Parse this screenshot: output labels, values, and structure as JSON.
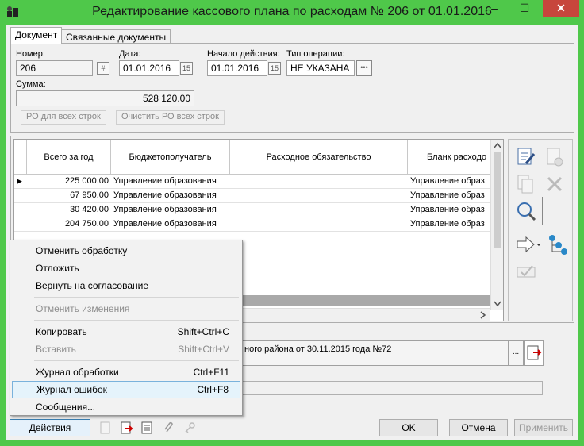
{
  "window": {
    "title": "Редактирование кассового плана по расходам № 206 от 01.01.2016",
    "min": "–",
    "max": "☐",
    "close": "✕"
  },
  "tabs": [
    "Документ",
    "Связанные документы"
  ],
  "form": {
    "number_label": "Номер:",
    "number_value": "206",
    "date_label": "Дата:",
    "date_value": "01.01.2016",
    "start_label": "Начало действия:",
    "start_value": "01.01.2016",
    "optype_label": "Тип операции:",
    "optype_value": "НЕ УКАЗАНА",
    "optype_btn": "•••",
    "sum_label": "Сумма:",
    "sum_value": "528 120.00",
    "btn_ro_all": "РО для всех строк",
    "btn_clear_ro": "Очистить РО  всех строк",
    "calendar_icon": "15",
    "hash_icon": "#"
  },
  "grid": {
    "columns": [
      "Всего за год",
      "Бюджетополучатель",
      "Расходное обязательство",
      "Бланк расходо"
    ],
    "rows": [
      [
        "225 000.00",
        "Управление образования",
        "",
        "Управление образ"
      ],
      [
        "67 950.00",
        "Управление образования",
        "",
        "Управление образ"
      ],
      [
        "30 420.00",
        "Управление образования",
        "",
        "Управление образ"
      ],
      [
        "204 750.00",
        "Управление образования",
        "",
        "Управление образ"
      ]
    ]
  },
  "basis": {
    "text": "ного района от 30.11.2015 года №72",
    "dots": "..."
  },
  "menu": {
    "items": [
      {
        "label": "Отменить обработку",
        "shortcut": "",
        "disabled": false
      },
      {
        "label": "Отложить",
        "shortcut": "",
        "disabled": false
      },
      {
        "label": "Вернуть на согласование",
        "shortcut": "",
        "disabled": false
      },
      {
        "label": "Отменить изменения",
        "shortcut": "",
        "disabled": true
      },
      {
        "label": "Копировать",
        "shortcut": "Shift+Ctrl+C",
        "disabled": false
      },
      {
        "label": "Вставить",
        "shortcut": "Shift+Ctrl+V",
        "disabled": true
      },
      {
        "label": "Журнал обработки",
        "shortcut": "Ctrl+F11",
        "disabled": false
      },
      {
        "label": "Журнал ошибок",
        "shortcut": "Ctrl+F8",
        "disabled": false
      },
      {
        "label": "Сообщения...",
        "shortcut": "",
        "disabled": false
      }
    ]
  },
  "footer": {
    "actions": "Действия",
    "ok": "OK",
    "cancel": "Отмена",
    "apply": "Применить"
  },
  "colors": {
    "titlebar": "#4fc84a",
    "close": "#c7463c",
    "highlight": "#e5f3fb"
  }
}
